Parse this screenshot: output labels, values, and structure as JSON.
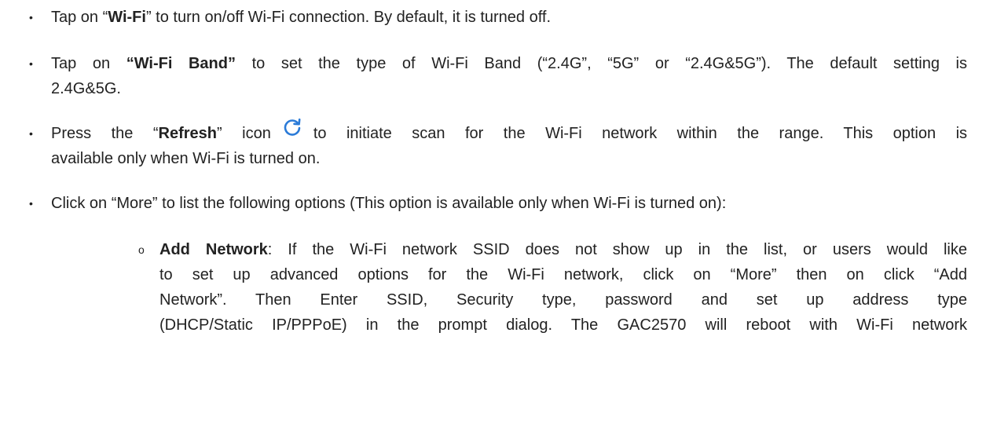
{
  "bullets": {
    "wifi": {
      "pre": "Tap on “",
      "bold": "Wi-Fi",
      "post": "” to turn on/off Wi-Fi connection. By default, it is turned off."
    },
    "band": {
      "pre": "Tap on ",
      "bold": "“Wi-Fi Band”",
      "post_line1": " to set the type of Wi-Fi Band (“2.4G”, “5G” or “2.4G&5G”). The default setting is",
      "line2": "2.4G&5G."
    },
    "refresh": {
      "pre": "Press the “",
      "bold": "Refresh",
      "mid": "” icon",
      "post_line1": "to initiate scan for the Wi-Fi network within the range. This option is",
      "line2": "available only when Wi-Fi is turned on.",
      "icon": "refresh-icon",
      "icon_color": "#2b7bd8"
    },
    "more": {
      "text": "Click on “More” to list the following options (This option is available only when Wi-Fi is turned on):"
    }
  },
  "sub_bullets": {
    "add_network": {
      "bold": "Add Network",
      "line1": ": If the Wi-Fi network SSID does not show up in the list, or users would like",
      "line2": "to set up advanced options for the Wi-Fi network, click on “More” then on click “Add",
      "line3": "Network”. Then Enter SSID, Security type, password and set up address type",
      "line4": "(DHCP/Static IP/PPPoE) in the prompt dialog. The GAC2570 will reboot with Wi-Fi network"
    }
  },
  "glyphs": {
    "bullet": "•",
    "sub_bullet": "o"
  }
}
